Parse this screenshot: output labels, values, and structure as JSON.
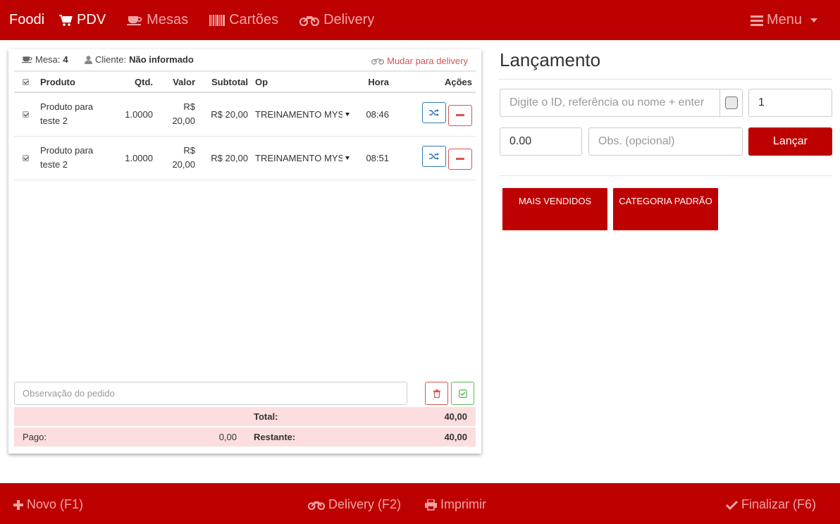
{
  "nav": {
    "brand": "Foodi",
    "items": [
      {
        "label": "PDV",
        "icon": "cart-icon",
        "active": true
      },
      {
        "label": "Mesas",
        "icon": "cup-icon",
        "active": false
      },
      {
        "label": "Cartões",
        "icon": "barcode-icon",
        "active": false
      },
      {
        "label": "Delivery",
        "icon": "motorcycle-icon",
        "active": false
      }
    ],
    "menu_label": "Menu"
  },
  "order": {
    "mesa_label": "Mesa:",
    "mesa_value": "4",
    "cliente_label": "Cliente:",
    "cliente_value": "Não informado",
    "mudar_delivery": "Mudar para delivery",
    "columns": {
      "produto": "Produto",
      "qtd": "Qtd.",
      "valor": "Valor",
      "subtotal": "Subtotal",
      "op": "Op",
      "hora": "Hora",
      "acoes": "Ações"
    },
    "rows": [
      {
        "produto": "Produto para teste 2",
        "qtd": "1.0000",
        "valor": "R$ 20,00",
        "subtotal": "R$ 20,00",
        "op": "TREINAMENTO MYSQL",
        "hora": "08:46",
        "checked": true
      },
      {
        "produto": "Produto para teste 2",
        "qtd": "1.0000",
        "valor": "R$ 20,00",
        "subtotal": "R$ 20,00",
        "op": "TREINAMENTO MYSQL",
        "hora": "08:51",
        "checked": true
      }
    ],
    "obs_placeholder": "Observação do pedido",
    "totals": {
      "total_label": "Total:",
      "total_value": "40,00",
      "pago_label": "Pago:",
      "pago_value": "0,00",
      "restante_label": "Restante:",
      "restante_value": "40,00"
    }
  },
  "lancamento": {
    "title": "Lançamento",
    "search_placeholder": "Digite o ID, referência ou nome + enter",
    "quantity_value": "1",
    "price_value": "0.00",
    "obs_placeholder": "Obs. (opcional)",
    "lancar_label": "Lançar",
    "categories": [
      "MAIS VENDIDOS",
      "CATEGORIA PADRÃO"
    ]
  },
  "footer": {
    "novo": "Novo (F1)",
    "delivery": "Delivery (F2)",
    "imprimir": "Imprimir",
    "finalizar": "Finalizar (F6)"
  },
  "colors": {
    "brand_red": "#bd0000",
    "nav_inactive": "#f2a5a5",
    "totals_bg": "#fcdede",
    "action_blue": "#337ab7",
    "action_red": "#d9534f",
    "action_green": "#5cb85c"
  }
}
